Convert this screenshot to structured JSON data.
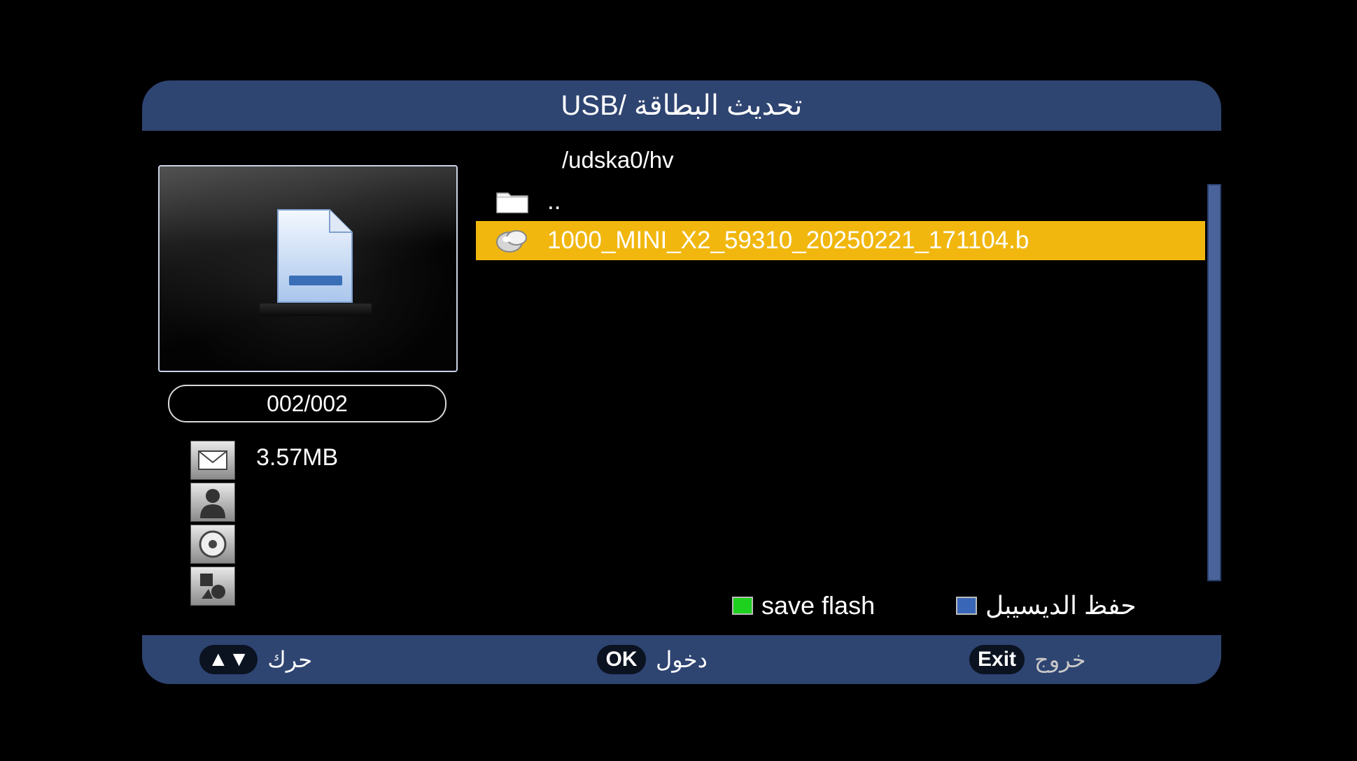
{
  "title": "تحديث البطاقة  /USB",
  "preview": {
    "counter": "002/002",
    "file_size": "3.57MB",
    "info_icons": [
      "mail-icon",
      "user-icon",
      "disc-icon",
      "shapes-icon"
    ]
  },
  "browser": {
    "path": "/udska0/hv",
    "items": [
      {
        "icon": "folder-icon",
        "label": "..",
        "selected": false
      },
      {
        "icon": "file-icon",
        "label": "1000_MINI_X2_59310_20250221_171104.b",
        "selected": true
      }
    ]
  },
  "color_keys": {
    "green": {
      "label": "save flash",
      "color": "#1fd11f"
    },
    "blue": {
      "label": "حفظ الديسيبل",
      "color": "#3a66b8"
    }
  },
  "footer": {
    "move": {
      "key": "▲▼",
      "label": "حرك"
    },
    "ok": {
      "key": "OK",
      "label": "دخول"
    },
    "exit": {
      "key": "Exit",
      "label": "خروج"
    }
  },
  "colors": {
    "bar": "#2e4471",
    "highlight": "#f1b70e",
    "scrollbar": "#4a639b"
  }
}
